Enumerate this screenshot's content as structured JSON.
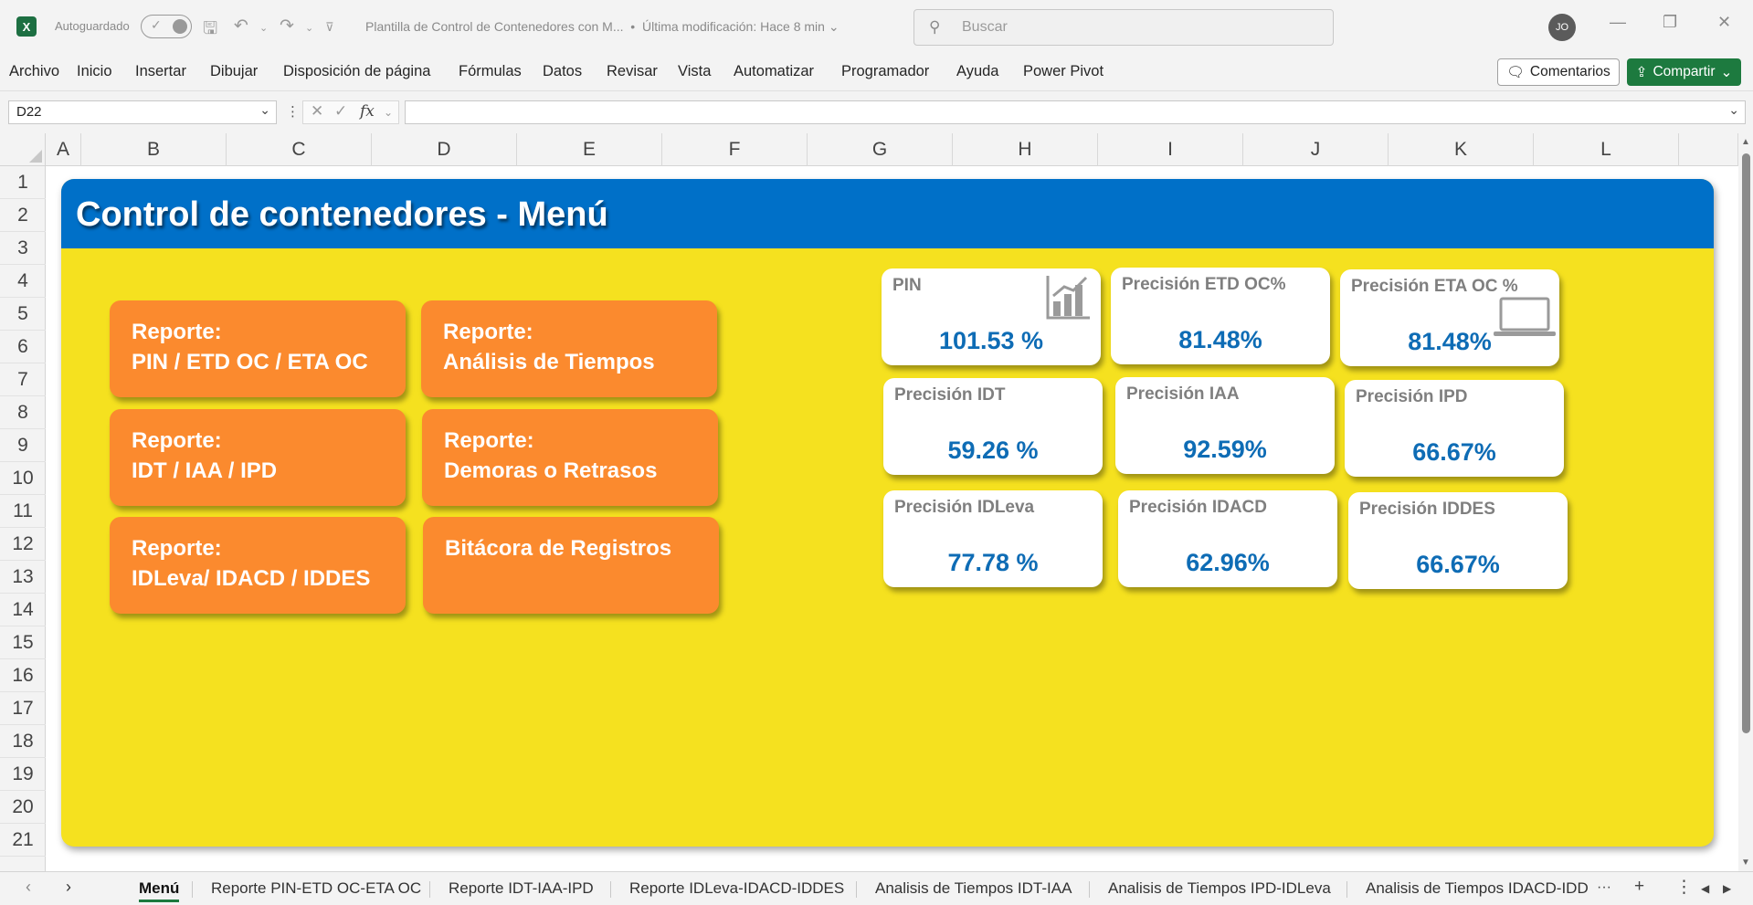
{
  "titlebar": {
    "app_logo": "X",
    "autosave_label": "Autoguardado",
    "doc_title": "Plantilla de Control de Contenedores con M...",
    "last_modified": "Última modificación: Hace 8 min",
    "search_placeholder": "Buscar",
    "avatar_initials": "JO"
  },
  "menu": {
    "items": [
      "Archivo",
      "Inicio",
      "Insertar",
      "Dibujar",
      "Disposición de página",
      "Fórmulas",
      "Datos",
      "Revisar",
      "Vista",
      "Automatizar",
      "Programador",
      "Ayuda",
      "Power Pivot"
    ],
    "comments_label": "Comentarios",
    "share_label": "Compartir"
  },
  "formula_bar": {
    "name_box": "D22",
    "fx": "fx",
    "value": ""
  },
  "grid": {
    "columns": [
      "A",
      "B",
      "C",
      "D",
      "E",
      "F",
      "G",
      "H",
      "I",
      "J",
      "K",
      "L"
    ],
    "rows": [
      "1",
      "2",
      "3",
      "4",
      "5",
      "6",
      "7",
      "8",
      "9",
      "10",
      "11",
      "12",
      "13",
      "14",
      "15",
      "16",
      "17",
      "18",
      "19",
      "20",
      "21"
    ]
  },
  "dashboard": {
    "title": "Control de contenedores - Menú",
    "buttons": [
      {
        "line1": "Reporte:",
        "line2": "PIN / ETD OC / ETA OC"
      },
      {
        "line1": "Reporte:",
        "line2": "Análisis de Tiempos"
      },
      {
        "line1": "Reporte:",
        "line2": "IDT / IAA / IPD"
      },
      {
        "line1": "Reporte:",
        "line2": "Demoras o Retrasos"
      },
      {
        "line1": "Reporte:",
        "line2": "IDLeva/ IDACD / IDDES"
      },
      {
        "line1": "Bitácora de Registros",
        "line2": ""
      }
    ],
    "kpis": [
      {
        "label": "PIN",
        "value": "101.53 %"
      },
      {
        "label": "Precisión ETD OC%",
        "value": "81.48%"
      },
      {
        "label": "Precisión ETA OC %",
        "value": "81.48%"
      },
      {
        "label": "Precisión IDT",
        "value": "59.26 %"
      },
      {
        "label": "Precisión IAA",
        "value": "92.59%"
      },
      {
        "label": "Precisión IPD",
        "value": "66.67%"
      },
      {
        "label": "Precisión IDLeva",
        "value": "77.78 %"
      },
      {
        "label": "Precisión IDACD",
        "value": "62.96%"
      },
      {
        "label": "Precisión IDDES",
        "value": "66.67%"
      }
    ],
    "colors": {
      "header": "#0070c8",
      "background": "#f5e11f",
      "button": "#fb8a2e",
      "kpi_value": "#0e6cb5"
    }
  },
  "sheet_tabs": {
    "tabs": [
      "Menú",
      "Reporte PIN-ETD OC-ETA OC",
      "Reporte IDT-IAA-IPD",
      "Reporte IDLeva-IDACD-IDDES",
      "Analisis de Tiempos IDT-IAA",
      "Analisis de Tiempos IPD-IDLeva",
      "Analisis de Tiempos IDACD-IDD"
    ],
    "active": "Menú",
    "add_label": "+",
    "more_label": "···"
  }
}
